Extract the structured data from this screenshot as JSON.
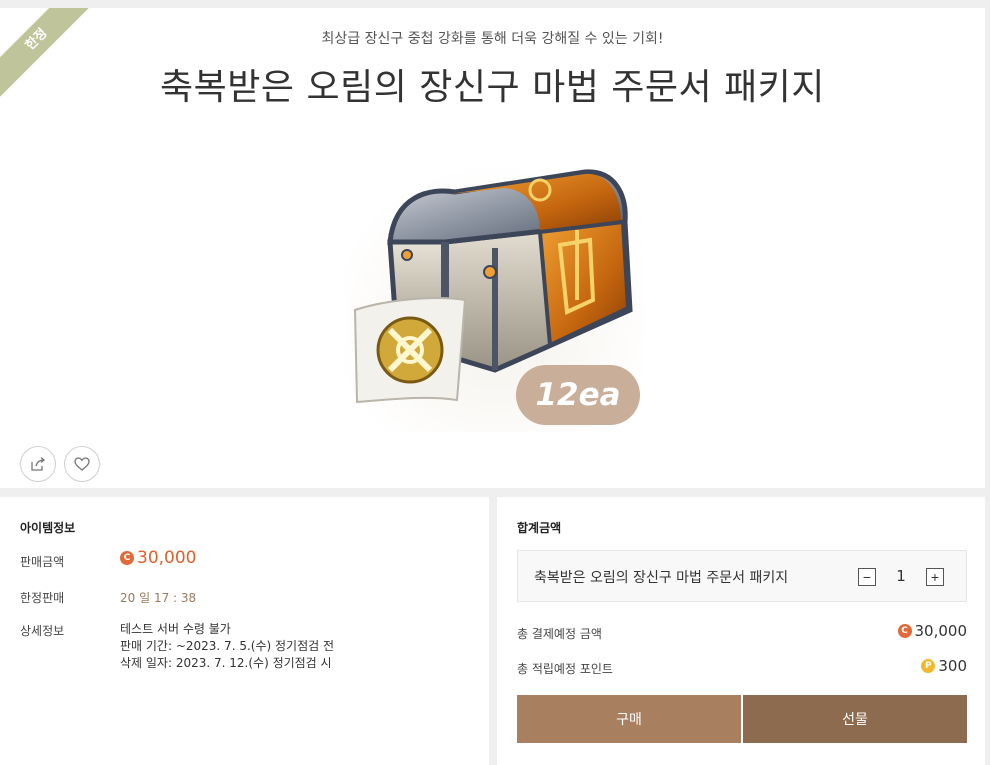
{
  "hero": {
    "ribbon": "한정",
    "subtitle": "최상급 장신구 중첩 강화를 통해 더욱 강해질 수 있는 기회!",
    "title": "축복받은 오림의 장신구 마법 주문서 패키지",
    "badge": "12ea",
    "share_icon": "share-icon",
    "like_icon": "heart-icon"
  },
  "info": {
    "heading": "아이템정보",
    "price_label": "판매금액",
    "coin_symbol": "C",
    "price_value": "30,000",
    "limit_label": "한정판매",
    "limit_value": "20 일 17 : 38",
    "detail_label": "상세정보",
    "detail_lines": [
      "테스트 서버 수령 불가",
      "판매 기간: ~2023. 7. 5.(수) 정기점검 전",
      "삭제 일자: 2023. 7. 12.(수) 정기점검 시"
    ]
  },
  "total": {
    "heading": "합계금액",
    "item_name": "축복받은 오림의 장신구 마법 주문서 패키지",
    "quantity": "1",
    "minus_label": "−",
    "plus_label": "+",
    "pay_label": "총 결제예정 금액",
    "pay_coin": "C",
    "pay_value": "30,000",
    "point_label": "총 적립예정 포인트",
    "point_coin": "P",
    "point_value": "300"
  },
  "buttons": {
    "buy": "구매",
    "gift": "선물"
  },
  "colors": {
    "accent_coin": "#e06a3a",
    "point_coin": "#f2b82e",
    "buy_button": "#a8805f",
    "gift_button": "#8d6b4e",
    "ribbon": "#bfc49a"
  }
}
